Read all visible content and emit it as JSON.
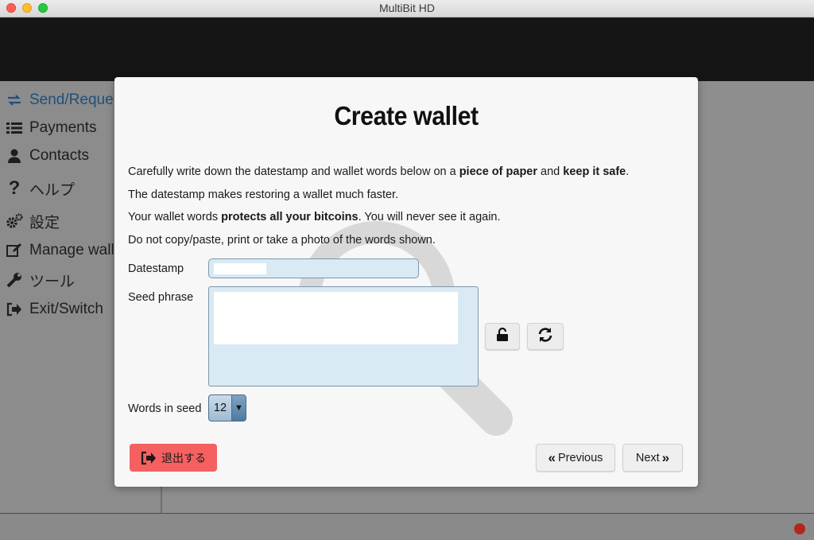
{
  "window": {
    "title": "MultiBit HD"
  },
  "sidebar": {
    "items": [
      {
        "label": "Send/Reque",
        "icon": "send-request-icon"
      },
      {
        "label": "Payments",
        "icon": "list-icon"
      },
      {
        "label": "Contacts",
        "icon": "user-icon"
      },
      {
        "label": "ヘルプ",
        "icon": "question-icon"
      },
      {
        "label": "設定",
        "icon": "cogs-icon"
      },
      {
        "label": "Manage wall",
        "icon": "edit-icon"
      },
      {
        "label": "ツール",
        "icon": "wrench-icon"
      },
      {
        "label": "Exit/Switch",
        "icon": "sign-out-icon"
      }
    ]
  },
  "modal": {
    "title": "Create wallet",
    "line1": {
      "a": "Carefully write down the datestamp and wallet words below on a ",
      "b": "piece of paper",
      "c": " and ",
      "d": "keep it safe",
      "e": "."
    },
    "line2": "The datestamp makes restoring a wallet much faster.",
    "line3": {
      "a": "Your wallet words ",
      "b": "protects all your bitcoins",
      "c": ". You will never see it again."
    },
    "line4": "Do not copy/paste, print or take a photo of the words shown.",
    "datestamp_label": "Datestamp",
    "seed_label": "Seed phrase",
    "words_label": "Words in seed",
    "words_value": "12",
    "exit_label": "退出する",
    "previous_label": "Previous",
    "next_label": "Next"
  },
  "colors": {
    "exit_button": "#f46160",
    "field_background": "#d9eaf4",
    "header": "#151515",
    "status_dot": "#b3261e"
  }
}
